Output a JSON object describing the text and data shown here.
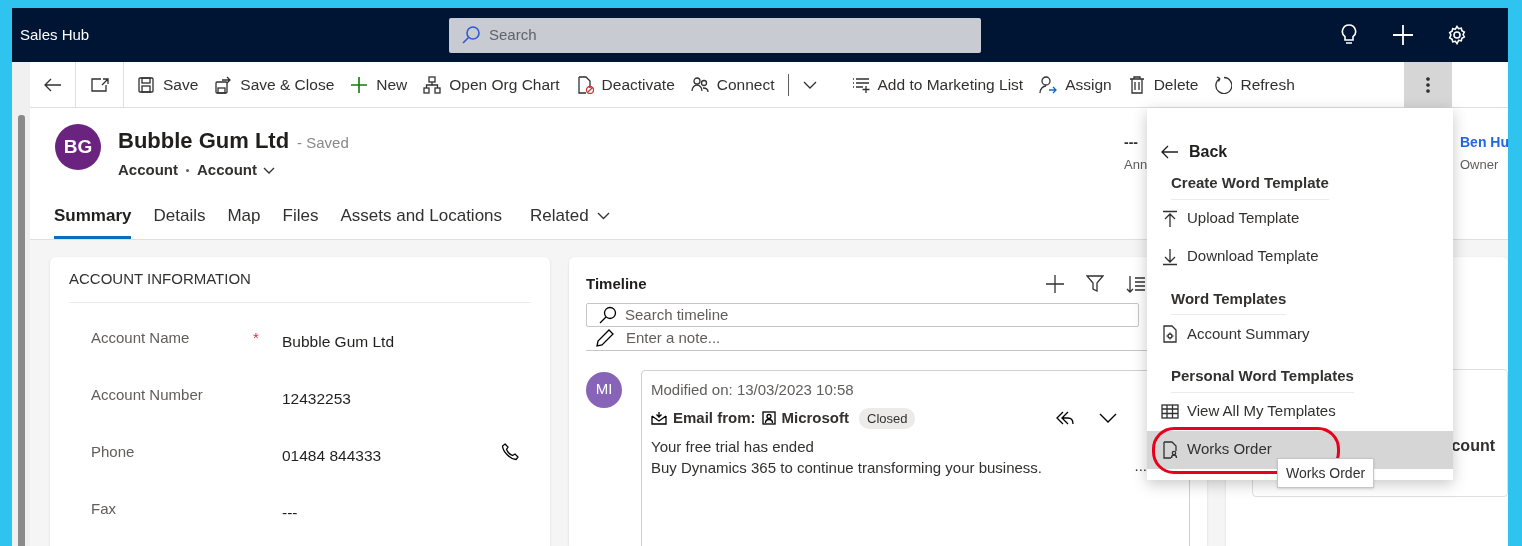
{
  "top_bar": {
    "app_name": "Sales Hub",
    "search": {
      "placeholder": "Search"
    }
  },
  "command_bar": {
    "items": [
      {
        "kind": "save",
        "label": "Save"
      },
      {
        "kind": "save-close",
        "label": "Save & Close"
      },
      {
        "kind": "new",
        "label": "New"
      },
      {
        "kind": "org-chart",
        "label": "Open Org Chart"
      },
      {
        "kind": "deactivate",
        "label": "Deactivate"
      },
      {
        "kind": "connect",
        "label": "Connect",
        "split": true
      },
      {
        "kind": "add-list",
        "label": "Add to Marketing List"
      },
      {
        "kind": "assign",
        "label": "Assign"
      },
      {
        "kind": "delete",
        "label": "Delete"
      },
      {
        "kind": "refresh",
        "label": "Refresh"
      }
    ],
    "more_open": true
  },
  "header": {
    "initials": "BG",
    "title": "Bubble Gum Ltd",
    "save_state": "- Saved",
    "entity": "Account",
    "form": "Account",
    "fields": [
      {
        "value": "---",
        "label": "Ann",
        "link": false
      },
      {
        "value": "Ben Hu",
        "label": "Owner",
        "link": true
      }
    ]
  },
  "tabs": [
    {
      "label": "Summary",
      "selected": true,
      "has_menu": false
    },
    {
      "label": "Details",
      "selected": false,
      "has_menu": false
    },
    {
      "label": "Map",
      "selected": false,
      "has_menu": false
    },
    {
      "label": "Files",
      "selected": false,
      "has_menu": false
    },
    {
      "label": "Assets and Locations",
      "selected": false,
      "has_menu": false
    },
    {
      "label": "Related",
      "selected": false,
      "has_menu": true
    }
  ],
  "account_info": {
    "title": "ACCOUNT INFORMATION",
    "required_marker": "*",
    "fields": [
      {
        "label": "Account Name",
        "value": "Bubble Gum Ltd",
        "required": true,
        "kind": "text"
      },
      {
        "label": "Account Number",
        "value": "12432253",
        "required": false,
        "kind": "text"
      },
      {
        "label": "Phone",
        "value": "01484 844333",
        "required": false,
        "kind": "phone"
      },
      {
        "label": "Fax",
        "value": "---",
        "required": false,
        "kind": "text"
      }
    ]
  },
  "timeline": {
    "title": "Timeline",
    "search": {
      "placeholder": "Search timeline"
    },
    "note": {
      "placeholder": "Enter a note..."
    },
    "activities": [
      {
        "initials": "MI",
        "modified": "Modified on: 13/03/2023 10:58",
        "type_label": "Email from:",
        "sender": "Microsoft",
        "status": "Closed",
        "lines": [
          "Your free trial has ended",
          "Buy Dynamics 365 to continue transforming your business."
        ],
        "more": "..."
      }
    ]
  },
  "right_card": {
    "text": "count"
  },
  "menu": {
    "back": "Back",
    "sections": [
      {
        "title": "Create Word Template",
        "items": [
          {
            "kind": "upload",
            "label": "Upload Template",
            "selected": false
          },
          {
            "kind": "download",
            "label": "Download Template",
            "selected": false
          }
        ]
      },
      {
        "title": "Word Templates",
        "items": [
          {
            "kind": "doc-gear",
            "label": "Account Summary",
            "selected": false
          }
        ]
      },
      {
        "title": "Personal Word Templates",
        "items": [
          {
            "kind": "table",
            "label": "View All My Templates",
            "selected": false
          },
          {
            "kind": "doc-person",
            "label": "Works Order",
            "selected": true,
            "circled": true
          }
        ]
      }
    ],
    "tooltip": "Works Order"
  }
}
